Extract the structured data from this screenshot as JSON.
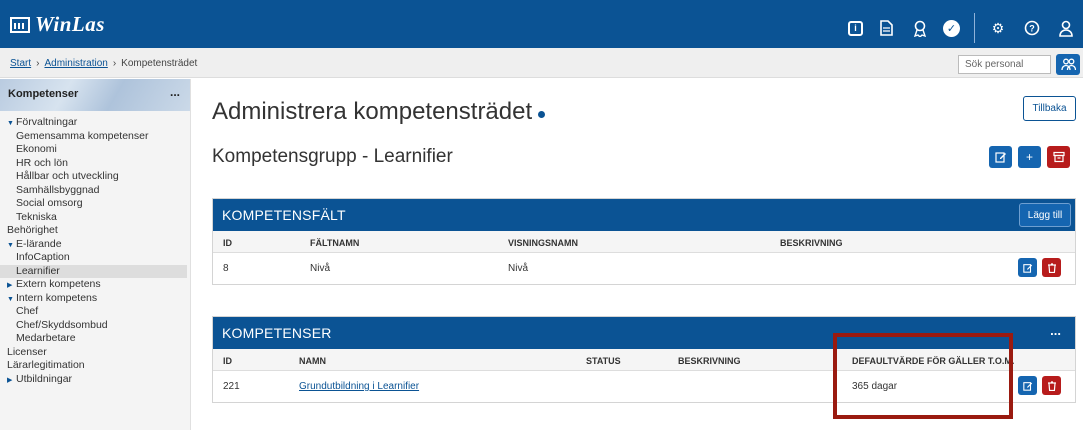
{
  "app": {
    "logo_text": "WinLas"
  },
  "topbar_icons": [
    "info-icon",
    "document-icon",
    "award-icon",
    "check-icon",
    "settings-icon",
    "help-icon",
    "user-icon"
  ],
  "breadcrumb": {
    "start": "Start",
    "admin": "Administration",
    "current": "Kompetensträdet",
    "sep": "›"
  },
  "search": {
    "placeholder": "Sök personal"
  },
  "sidebar": {
    "title": "Kompetenser",
    "menu": "...",
    "items": [
      {
        "label": "Förvaltningar",
        "level": 0,
        "caret": "down"
      },
      {
        "label": "Gemensamma kompetenser",
        "level": 1
      },
      {
        "label": "Ekonomi",
        "level": 1
      },
      {
        "label": "HR och lön",
        "level": 1
      },
      {
        "label": "Hållbar och utveckling",
        "level": 1
      },
      {
        "label": "Samhällsbyggnad",
        "level": 1
      },
      {
        "label": "Social omsorg",
        "level": 1
      },
      {
        "label": "Tekniska",
        "level": 1
      },
      {
        "label": "Behörighet",
        "level": 0
      },
      {
        "label": "E-lärande",
        "level": 0,
        "caret": "down"
      },
      {
        "label": "InfoCaption",
        "level": 1
      },
      {
        "label": "Learnifier",
        "level": 1,
        "selected": true
      },
      {
        "label": "Extern kompetens",
        "level": 0,
        "caret": "right"
      },
      {
        "label": "Intern kompetens",
        "level": 0,
        "caret": "down"
      },
      {
        "label": "Chef",
        "level": 1
      },
      {
        "label": "Chef/Skyddsombud",
        "level": 1
      },
      {
        "label": "Medarbetare",
        "level": 1
      },
      {
        "label": "Licenser",
        "level": 0
      },
      {
        "label": "Lärarlegitimation",
        "level": 0
      },
      {
        "label": "Utbildningar",
        "level": 0,
        "caret": "right"
      }
    ]
  },
  "main": {
    "title": "Administrera kompetensträdet",
    "back_label": "Tillbaka",
    "group_title": "Kompetensgrupp - Learnifier"
  },
  "kompetensfalt": {
    "title": "KOMPETENSFÄLT",
    "add_label": "Lägg till",
    "columns": [
      "ID",
      "FÄLTNAMN",
      "VISNINGSNAMN",
      "BESKRIVNING"
    ],
    "rows": [
      {
        "id": "8",
        "faltnamn": "Nivå",
        "visningsnamn": "Nivå",
        "beskrivning": ""
      }
    ]
  },
  "kompetenser": {
    "title": "KOMPETENSER",
    "menu": "...",
    "columns": [
      "ID",
      "NAMN",
      "STATUS",
      "BESKRIVNING",
      "DEFAULTVÄRDE FÖR GÄLLER T.O.M."
    ],
    "rows": [
      {
        "id": "221",
        "namn": "Grundutbildning i Learnifier",
        "status": "",
        "beskrivning": "",
        "default": "365 dagar"
      }
    ]
  },
  "colors": {
    "primary": "#0b5394",
    "button_blue": "#1565b0",
    "danger": "#b71c1c",
    "highlight": "#9a1a10"
  }
}
